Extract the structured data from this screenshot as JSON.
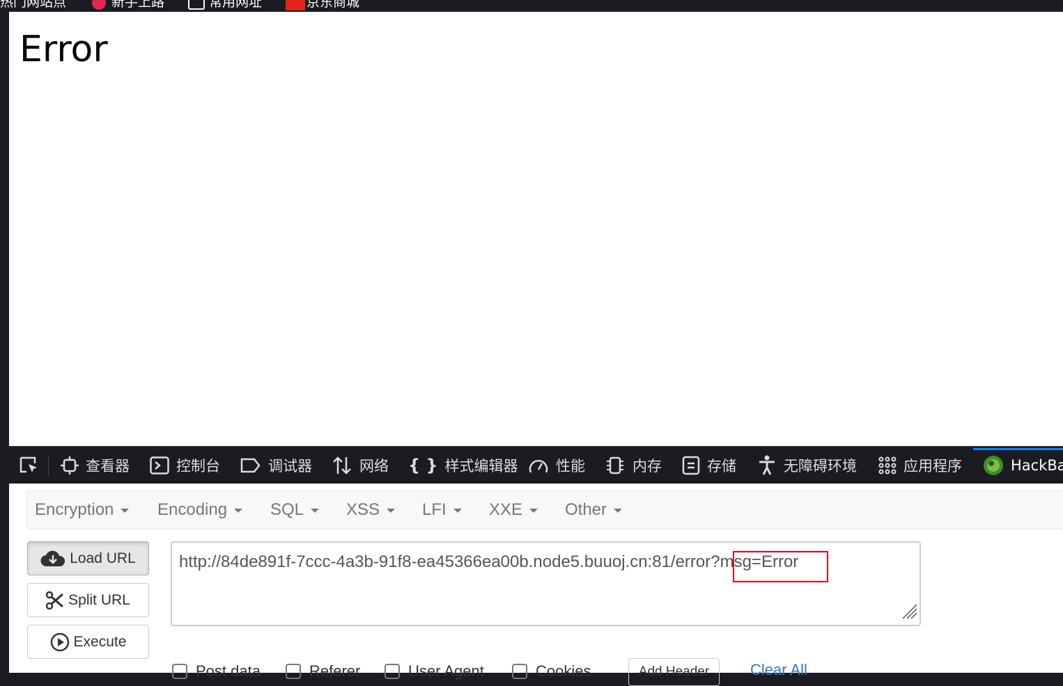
{
  "bookmarks": [
    {
      "label": "热门网站点",
      "icon": "bookmark-icon"
    },
    {
      "label": "新手上路",
      "icon": "firefox-icon"
    },
    {
      "label": "常用网址",
      "icon": "folder-icon"
    },
    {
      "label": "京东商城",
      "icon": "jd-icon"
    }
  ],
  "page": {
    "heading": "Error"
  },
  "devtools": {
    "tabs": [
      {
        "label": "查看器",
        "icon": "inspector-icon"
      },
      {
        "label": "控制台",
        "icon": "console-icon"
      },
      {
        "label": "调试器",
        "icon": "debugger-icon"
      },
      {
        "label": "网络",
        "icon": "network-icon"
      },
      {
        "label": "样式编辑器",
        "icon": "style-editor-icon"
      },
      {
        "label": "性能",
        "icon": "performance-icon"
      },
      {
        "label": "内存",
        "icon": "memory-icon"
      },
      {
        "label": "存储",
        "icon": "storage-icon"
      },
      {
        "label": "无障碍环境",
        "icon": "accessibility-icon"
      },
      {
        "label": "应用程序",
        "icon": "application-icon"
      },
      {
        "label": "HackBa",
        "icon": "hackbar-icon",
        "active": true
      }
    ],
    "accent": "#0a84ff"
  },
  "hackbar": {
    "menu": [
      "Encryption",
      "Encoding",
      "SQL",
      "XSS",
      "LFI",
      "XXE",
      "Other"
    ],
    "buttons": {
      "load": "Load URL",
      "split": "Split URL",
      "execute": "Execute"
    },
    "url": "http://84de891f-7ccc-4a3b-91f8-ea45366ea00b.node5.buuoj.cn:81/error?msg=Error",
    "options": [
      "Post data",
      "Referer",
      "User Agent",
      "Cookies"
    ],
    "add_header": "Add Header",
    "clear_all": "Clear All",
    "highlight_color": "#e60012"
  }
}
